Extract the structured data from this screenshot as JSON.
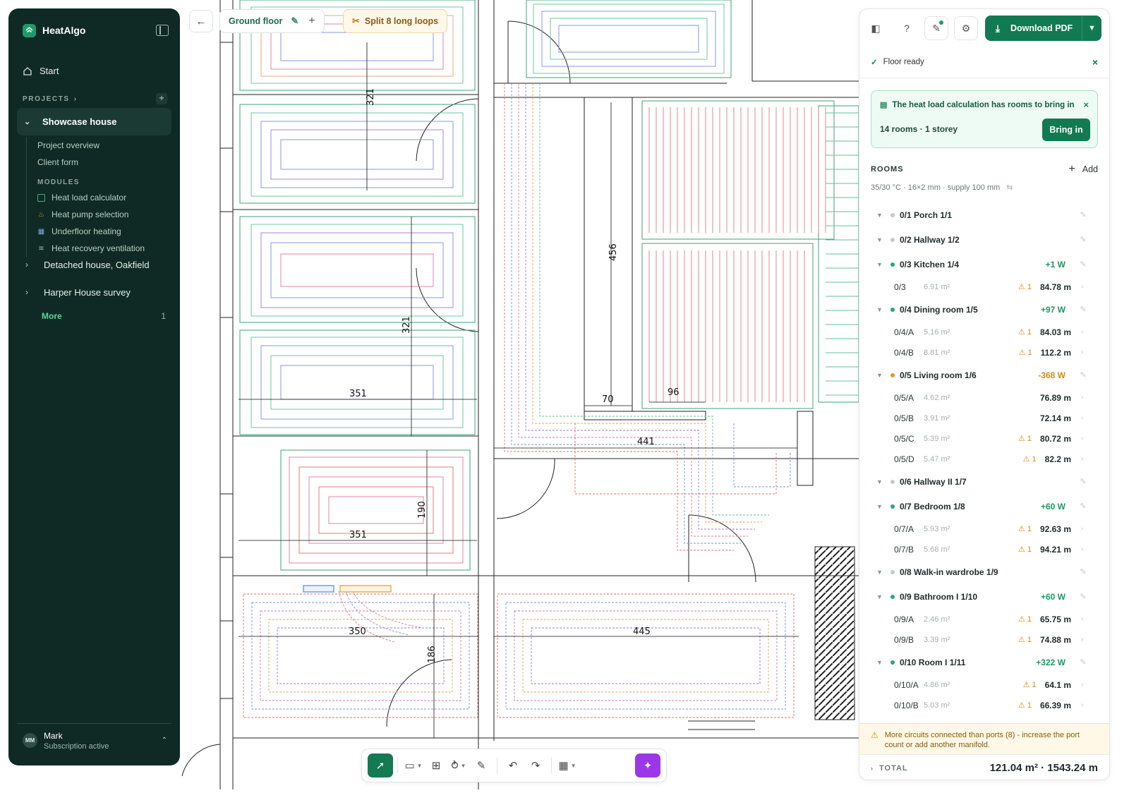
{
  "app": {
    "name": "HeatAlgo"
  },
  "sidebar": {
    "start_label": "Start",
    "projects_label": "PROJECTS",
    "active_project": "Showcase house",
    "project_links": [
      "Project overview",
      "Client form"
    ],
    "modules_label": "MODULES",
    "modules": [
      {
        "label": "Heat load calculator",
        "icon": "calculator-icon"
      },
      {
        "label": "Heat pump selection",
        "icon": "flame-icon"
      },
      {
        "label": "Underfloor heating",
        "icon": "grid-icon"
      },
      {
        "label": "Heat recovery ventilation",
        "icon": "wind-icon"
      }
    ],
    "other_projects": [
      "Detached house, Oakfield",
      "Harper House survey"
    ],
    "more_label": "More",
    "more_count": "1",
    "user": {
      "initials": "MM",
      "name": "Mark",
      "status": "Subscription active"
    }
  },
  "topbar": {
    "floor_label": "Ground floor",
    "split_label": "Split 8 long loops"
  },
  "panel": {
    "download_label": "Download PDF",
    "status_text": "Floor ready",
    "notice": {
      "title": "The heat load calculation has rooms to bring in",
      "summary": "14 rooms · 1 storey",
      "button": "Bring in"
    },
    "rooms_label": "ROOMS",
    "add_label": "Add",
    "params": "35/30 °C · 16×2 mm · supply 100 mm",
    "rooms": [
      {
        "name": "0/1 Porch 1/1",
        "dot": "#c4cac8",
        "watts": "",
        "wcolor": "#1a8a5c",
        "circuits": []
      },
      {
        "name": "0/2 Hallway 1/2",
        "dot": "#c4cac8",
        "watts": "",
        "wcolor": "#1a8a5c",
        "circuits": []
      },
      {
        "name": "0/3 Kitchen 1/4",
        "dot": "#1fae6e",
        "watts": "+1 W",
        "wcolor": "#1a9a60",
        "circuits": [
          {
            "id": "0/3",
            "area": "6.91 m²",
            "warn": "1",
            "len": "84.78 m"
          }
        ]
      },
      {
        "name": "0/4 Dining room 1/5",
        "dot": "#1fae6e",
        "watts": "+97 W",
        "wcolor": "#1a9a60",
        "circuits": [
          {
            "id": "0/4/A",
            "area": "5.16 m²",
            "warn": "1",
            "len": "84.03 m"
          },
          {
            "id": "0/4/B",
            "area": "8.81 m²",
            "warn": "1",
            "len": "112.2 m"
          }
        ]
      },
      {
        "name": "0/5 Living room 1/6",
        "dot": "#e49a1a",
        "watts": "-368 W",
        "wcolor": "#d9890f",
        "circuits": [
          {
            "id": "0/5/A",
            "area": "4.62 m²",
            "warn": "",
            "len": "76.89 m"
          },
          {
            "id": "0/5/B",
            "area": "3.91 m²",
            "warn": "",
            "len": "72.14 m"
          },
          {
            "id": "0/5/C",
            "area": "5.39 m²",
            "warn": "1",
            "len": "80.72 m"
          },
          {
            "id": "0/5/D",
            "area": "5.47 m²",
            "warn": "1",
            "len": "82.2 m"
          }
        ]
      },
      {
        "name": "0/6 Hallway II 1/7",
        "dot": "#c4cac8",
        "watts": "",
        "wcolor": "#1a8a5c",
        "circuits": []
      },
      {
        "name": "0/7 Bedroom 1/8",
        "dot": "#1fae6e",
        "watts": "+60 W",
        "wcolor": "#1a9a60",
        "circuits": [
          {
            "id": "0/7/A",
            "area": "5.93 m²",
            "warn": "1",
            "len": "92.63 m"
          },
          {
            "id": "0/7/B",
            "area": "5.68 m²",
            "warn": "1",
            "len": "94.21 m"
          }
        ]
      },
      {
        "name": "0/8 Walk-in wardrobe 1/9",
        "dot": "#c4cac8",
        "watts": "",
        "wcolor": "#1a8a5c",
        "circuits": []
      },
      {
        "name": "0/9 Bathroom I 1/10",
        "dot": "#1fae6e",
        "watts": "+60 W",
        "wcolor": "#1a9a60",
        "circuits": [
          {
            "id": "0/9/A",
            "area": "2.46 m²",
            "warn": "1",
            "len": "65.75 m"
          },
          {
            "id": "0/9/B",
            "area": "3.39 m²",
            "warn": "1",
            "len": "74.88 m"
          }
        ]
      },
      {
        "name": "0/10 Room I 1/11",
        "dot": "#1fae6e",
        "watts": "+322 W",
        "wcolor": "#1a9a60",
        "circuits": [
          {
            "id": "0/10/A",
            "area": "4.86 m²",
            "warn": "1",
            "len": "64.1 m"
          },
          {
            "id": "0/10/B",
            "area": "5.03 m²",
            "warn": "1",
            "len": "66.39 m"
          }
        ]
      }
    ],
    "warning": "More circuits connected than ports (8) - increase the port count or add another manifold.",
    "total_label": "TOTAL",
    "total_value": "121.04 m² · 1543.24 m"
  },
  "plan_dimensions": [
    "321",
    "321",
    "456",
    "351",
    "70",
    "96",
    "441",
    "351",
    "190",
    "350",
    "186",
    "445"
  ],
  "colors": {
    "sidebar": "#0f2a24",
    "accent": "#127a52",
    "warning": "#d9890f",
    "magic": "#9b37e8"
  }
}
